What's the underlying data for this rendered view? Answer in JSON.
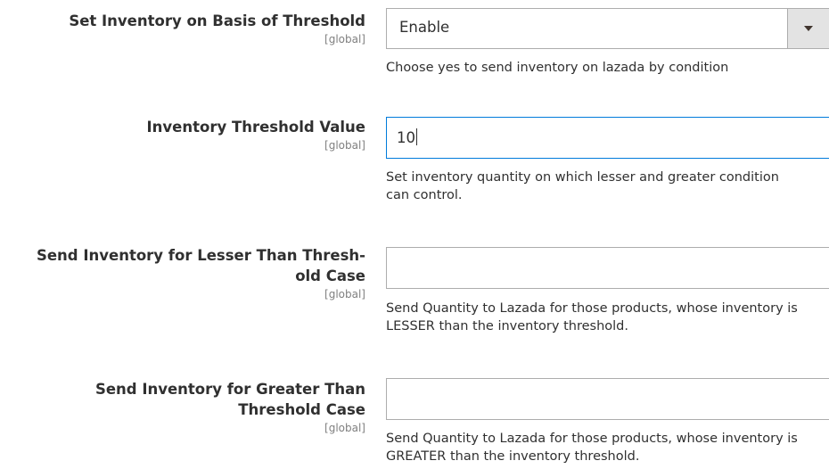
{
  "fields": [
    {
      "label": "Set Inventory on Basis of Threshold",
      "scope": "[global]",
      "control": "select",
      "value": "Enable",
      "note": "Choose yes to send inventory on lazada by condition"
    },
    {
      "label": "Inventory Threshold Value",
      "scope": "[global]",
      "control": "text",
      "value": "10",
      "note": "Set inventory quantity on which lesser and greater condition can control."
    },
    {
      "label_line1": "Send Inventory for Lesser Than Thresh-",
      "label_line2": "old Case",
      "scope": "[global]",
      "control": "text",
      "value": "",
      "note": "Send Quantity to Lazada for those products, whose inventory is LESSER than the inventory threshold."
    },
    {
      "label_line1": "Send Inventory for Greater Than",
      "label_line2": "Threshold Case",
      "scope": "[global]",
      "control": "text",
      "value": "",
      "note": "Send Quantity to Lazada for those products, whose inventory is GREATER than the inventory threshold."
    }
  ],
  "icons": {
    "select_arrow": "chevron-down-icon"
  },
  "colors": {
    "focus_border": "#007bdb",
    "border": "#adadad",
    "select_button_bg": "#e3e3e3"
  }
}
